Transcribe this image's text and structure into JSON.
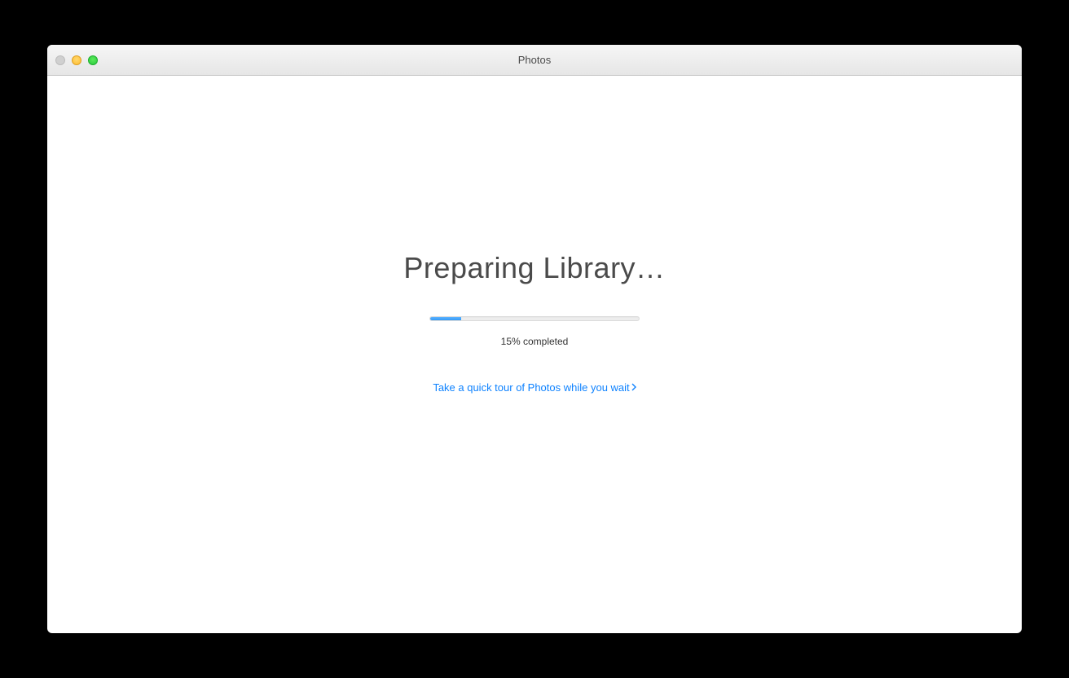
{
  "window": {
    "title": "Photos"
  },
  "main": {
    "heading": "Preparing Library…",
    "progress": {
      "percent": 15,
      "label": "15% completed"
    },
    "tour_link": "Take a quick tour of Photos while you wait"
  },
  "colors": {
    "link": "#0e82ff",
    "progress_fill": "#3498f5"
  }
}
